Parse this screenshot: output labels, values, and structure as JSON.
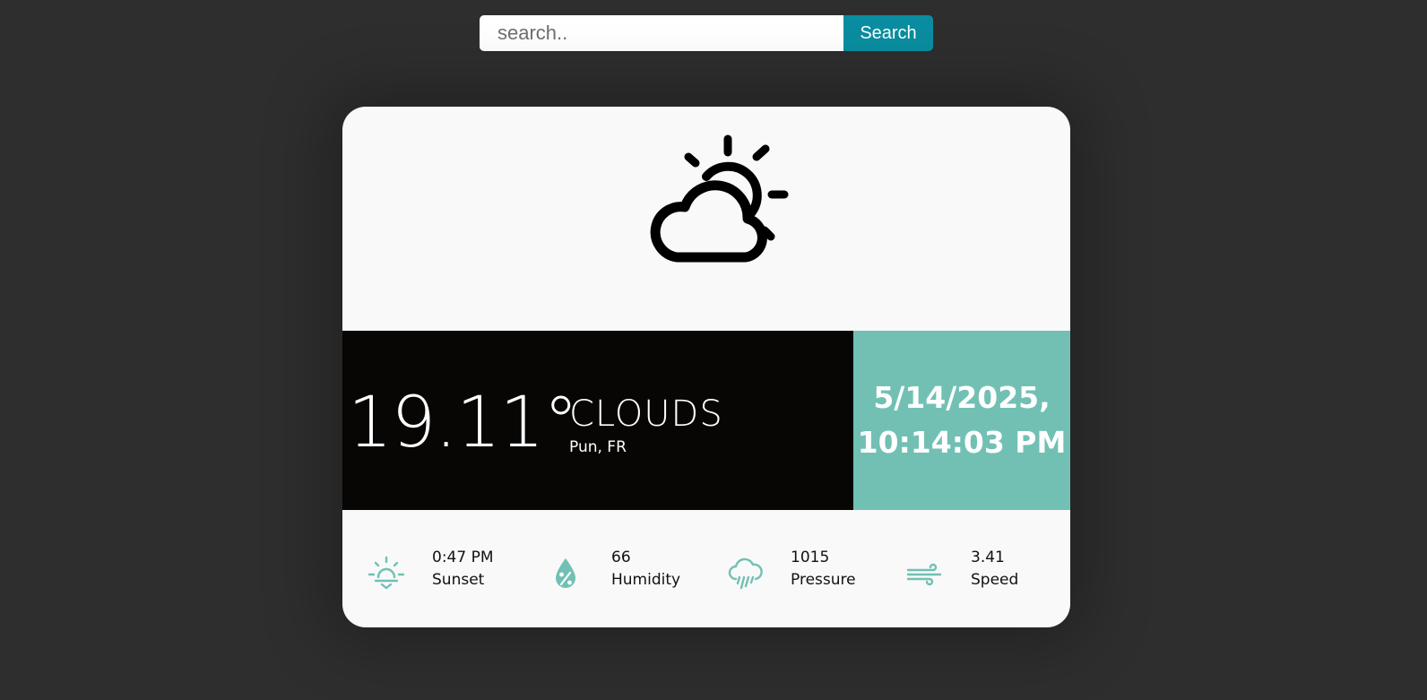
{
  "search": {
    "placeholder": "search..",
    "value": "",
    "button_label": "Search"
  },
  "weather": {
    "icon": "partly-cloudy-icon",
    "temperature": "19.11°",
    "condition": "CLOUDS",
    "location": "Pun, FR",
    "date_line1": "5/14/2025,",
    "date_line2": "10:14:03 PM"
  },
  "stats": [
    {
      "icon": "sunset-icon",
      "value": "0:47 PM",
      "label": "Sunset"
    },
    {
      "icon": "humidity-icon",
      "value": "66",
      "label": "Humidity"
    },
    {
      "icon": "pressure-rain-cloud-icon",
      "value": "1015",
      "label": "Pressure"
    },
    {
      "icon": "wind-icon",
      "value": "3.41",
      "label": "Speed"
    }
  ],
  "colors": {
    "background": "#2e2e2e",
    "accent_teal": "#72c0b4",
    "search_button": "#0a8da0",
    "temp_panel": "#070605",
    "card": "#f9f9f9"
  }
}
